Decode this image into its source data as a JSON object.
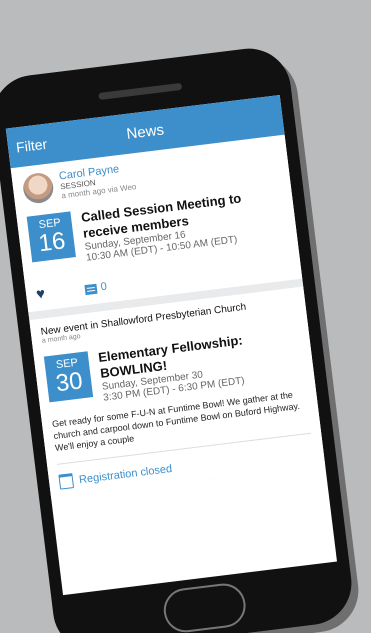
{
  "header": {
    "filter_label": "Filter",
    "title": "News"
  },
  "feed": [
    {
      "author": "Carol Payne",
      "group": "SESSION",
      "meta": "a month ago via Weo",
      "event": {
        "month": "SEP",
        "day": "16",
        "title": "Called Session Meeting to receive members",
        "date": "Sunday, September 16",
        "time": "10:30 AM (EDT) - 10:50 AM (EDT)"
      },
      "comments": "0"
    },
    {
      "notice": "New event in Shallowford Presbyterian Church",
      "meta": "a month ago",
      "event": {
        "month": "SEP",
        "day": "30",
        "title": "Elementary Fellowship: BOWLING!",
        "date": "Sunday, September 30",
        "time": "3:30 PM (EDT) - 6:30 PM (EDT)"
      },
      "description": "Get ready for some F-U-N at Funtime Bowl! We gather at the church and carpool down to Funtime Bowl on Buford Highway. We'll enjoy a couple",
      "registration": "Registration closed"
    }
  ],
  "icons": {
    "like": "heart-icon",
    "comment": "comment-icon",
    "registration": "calendar-icon"
  },
  "colors": {
    "accent": "#3d8fcb",
    "heart": "#1e3f66"
  }
}
